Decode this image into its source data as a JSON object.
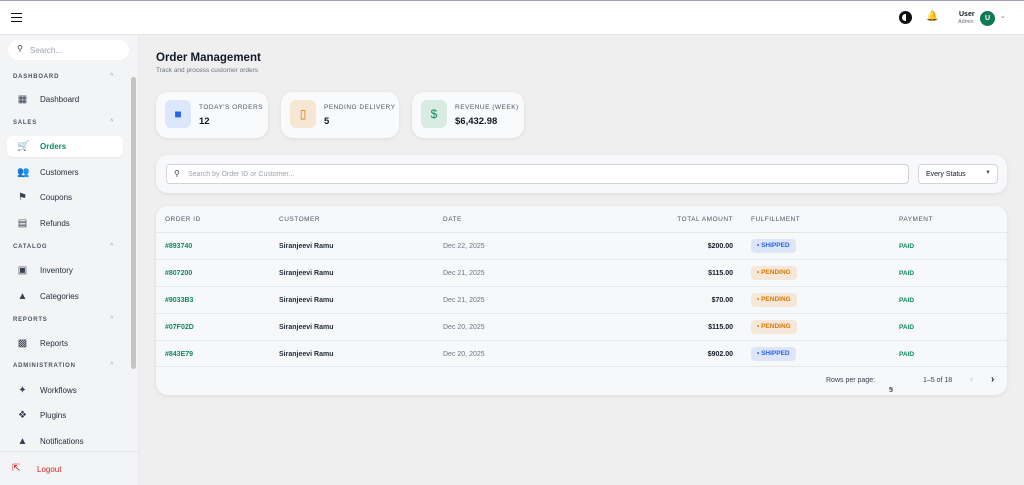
{
  "topbar": {
    "user_name": "User",
    "user_role": "Admin",
    "avatar_initial": "U"
  },
  "sidebar": {
    "search_placeholder": "Search...",
    "sections": [
      {
        "title": "DASHBOARD"
      },
      {
        "title": "SALES"
      },
      {
        "title": "CATALOG"
      },
      {
        "title": "REPORTS"
      },
      {
        "title": "ADMINISTRATION"
      }
    ],
    "items": [
      {
        "label": "Dashboard"
      },
      {
        "label": "Orders"
      },
      {
        "label": "Customers"
      },
      {
        "label": "Coupons"
      },
      {
        "label": "Refunds"
      },
      {
        "label": "Inventory"
      },
      {
        "label": "Categories"
      },
      {
        "label": "Reports"
      },
      {
        "label": "Workflows"
      },
      {
        "label": "Plugins"
      },
      {
        "label": "Notifications"
      }
    ],
    "logout": "Logout"
  },
  "page": {
    "title": "Order Management",
    "subtitle": "Track and process customer orders"
  },
  "stats": [
    {
      "label": "TODAY'S ORDERS",
      "value": "12"
    },
    {
      "label": "PENDING DELIVERY",
      "value": "5"
    },
    {
      "label": "REVENUE (WEEK)",
      "value": "$6,432.98"
    }
  ],
  "filters": {
    "search_placeholder": "Search by Order ID or Customer...",
    "status": "Every Status"
  },
  "table": {
    "headers": [
      "ORDER ID",
      "CUSTOMER",
      "DATE",
      "TOTAL AMOUNT",
      "FULFILLMENT",
      "PAYMENT"
    ],
    "rows": [
      {
        "id": "#893740",
        "customer": "Siranjeevi Ramu",
        "date": "Dec 22, 2025",
        "total": "$200.00",
        "fulfillment": "SHIPPED",
        "payment": "PAID"
      },
      {
        "id": "#807200",
        "customer": "Siranjeevi Ramu",
        "date": "Dec 21, 2025",
        "total": "$115.00",
        "fulfillment": "PENDING",
        "payment": "PAID"
      },
      {
        "id": "#9033B3",
        "customer": "Siranjeevi Ramu",
        "date": "Dec 21, 2025",
        "total": "$70.00",
        "fulfillment": "PENDING",
        "payment": "PAID"
      },
      {
        "id": "#07F02D",
        "customer": "Siranjeevi Ramu",
        "date": "Dec 20, 2025",
        "total": "$115.00",
        "fulfillment": "PENDING",
        "payment": "PAID"
      },
      {
        "id": "#843E79",
        "customer": "Siranjeevi Ramu",
        "date": "Dec 20, 2025",
        "total": "$902.00",
        "fulfillment": "SHIPPED",
        "payment": "PAID"
      }
    ],
    "rows_per_page_label": "Rows per page:",
    "rows_per_page": "5",
    "range": "1–5 of 18"
  },
  "colors": {
    "accent": "#0e8a5f",
    "shipped": "#2563eb",
    "pending": "#d97706",
    "danger": "#dc2626"
  }
}
